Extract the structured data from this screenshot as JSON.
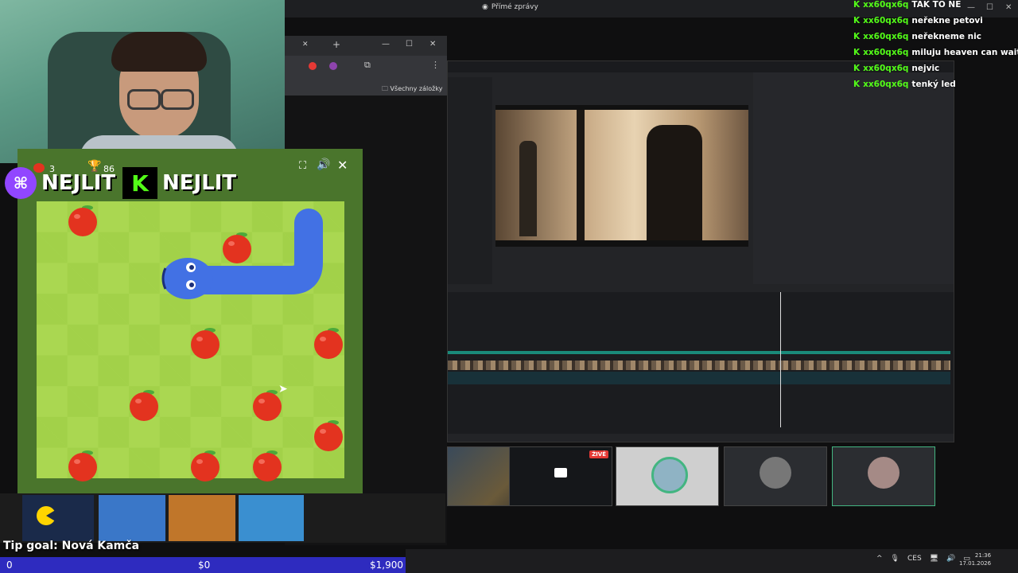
{
  "discord": {
    "title": "Přímé zprávy"
  },
  "browser": {
    "bookmarks_label": "Všechny záložky"
  },
  "game": {
    "score": "3",
    "best": "86",
    "colors": {
      "board_light": "#aad751",
      "board_dark": "#a2d149",
      "frame": "#4a752c",
      "snake": "#4271e4",
      "apple": "#e3331f"
    }
  },
  "overlay": {
    "twitch_name": "NEJLIT",
    "kick_name": "NEJLIT",
    "tip_goal": "Tip goal: Nová Kamča",
    "goal_current": "0",
    "goal_mid": "$0",
    "goal_max": "$1,900"
  },
  "chat": [
    {
      "user": "xx60qx6q",
      "msg": "TAK TO NE"
    },
    {
      "user": "xx60qx6q",
      "msg": "neřekne petovi"
    },
    {
      "user": "xx60qx6q",
      "msg": "neřekneme nic"
    },
    {
      "user": "xx60qx6q",
      "msg": "miluju heaven can wait"
    },
    {
      "user": "xx60qx6q",
      "msg": "nejvic"
    },
    {
      "user": "xx60qx6q",
      "msg": "tenký led"
    }
  ],
  "thumbnails": {
    "live_label": "ŽIVĚ"
  },
  "taskbar": {
    "language": "CES",
    "time": "21:36",
    "date": "17.01.2026"
  }
}
